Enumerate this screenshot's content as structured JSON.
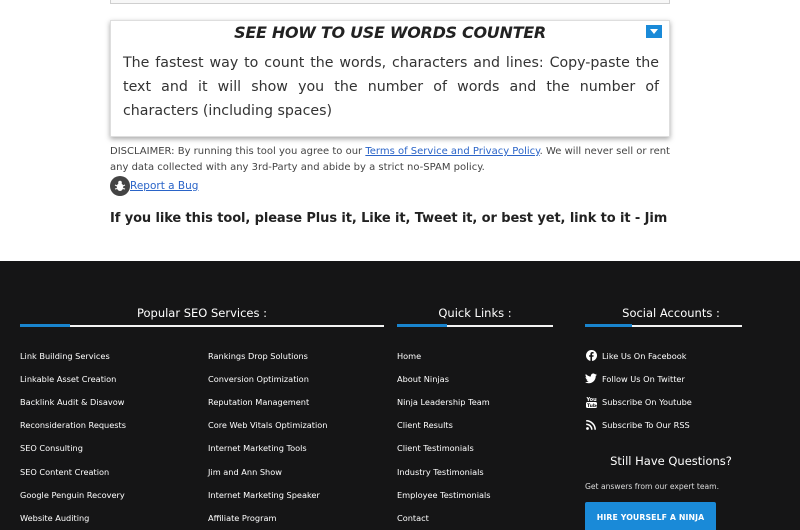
{
  "howto": {
    "title": "SEE HOW TO USE WORDS COUNTER",
    "body": "The fastest way to count the words, characters and lines: Copy-paste the text and it will show you the number of words and the number of characters (including spaces)"
  },
  "disclaimer": {
    "prefix": "DISCLAIMER: By running this tool you agree to our ",
    "link": "Terms of Service and Privacy Policy",
    "suffix": ". We will never sell or rent any data collected with any 3rd-Party and abide by a strict no-SPAM policy."
  },
  "bug": {
    "label": "Report a Bug"
  },
  "cta": "If you like this tool, please Plus it, Like it, Tweet it, or best yet, link to it - Jim",
  "footer": {
    "services": {
      "heading": "Popular SEO Services :",
      "col1": [
        "Link Building Services",
        "Linkable Asset Creation",
        "Backlink Audit & Disavow",
        "Reconsideration Requests",
        "SEO Consulting",
        "SEO Content Creation",
        "Google Penguin Recovery",
        "Website Auditing"
      ],
      "col2": [
        "Rankings Drop Solutions",
        "Conversion Optimization",
        "Reputation Management",
        "Core Web Vitals Optimization",
        "Internet Marketing Tools",
        "Jim and Ann Show",
        "Internet Marketing Speaker",
        "Affiliate Program"
      ]
    },
    "quick_links": {
      "heading": "Quick Links :",
      "items": [
        "Home",
        "About Ninjas",
        "Ninja Leadership Team",
        "Client Results",
        "Client Testimonials",
        "Industry Testimonials",
        "Employee Testimonials",
        "Contact"
      ]
    },
    "social": {
      "heading": "Social Accounts :",
      "items": [
        {
          "label": "Like Us On Facebook",
          "icon": "facebook-icon"
        },
        {
          "label": "Follow Us On Twitter",
          "icon": "twitter-icon"
        },
        {
          "label": "Subscribe On Youtube",
          "icon": "youtube-icon"
        },
        {
          "label": "Subscribe To Our RSS",
          "icon": "rss-icon"
        }
      ]
    },
    "questions": {
      "heading": "Still Have Questions?",
      "subtext": "Get answers from our expert team.",
      "button": "HIRE YOURSELF A NINJA"
    }
  },
  "colors": {
    "accent": "#1a8ad8",
    "footer_bg": "#151516",
    "link": "#2a64c8"
  }
}
